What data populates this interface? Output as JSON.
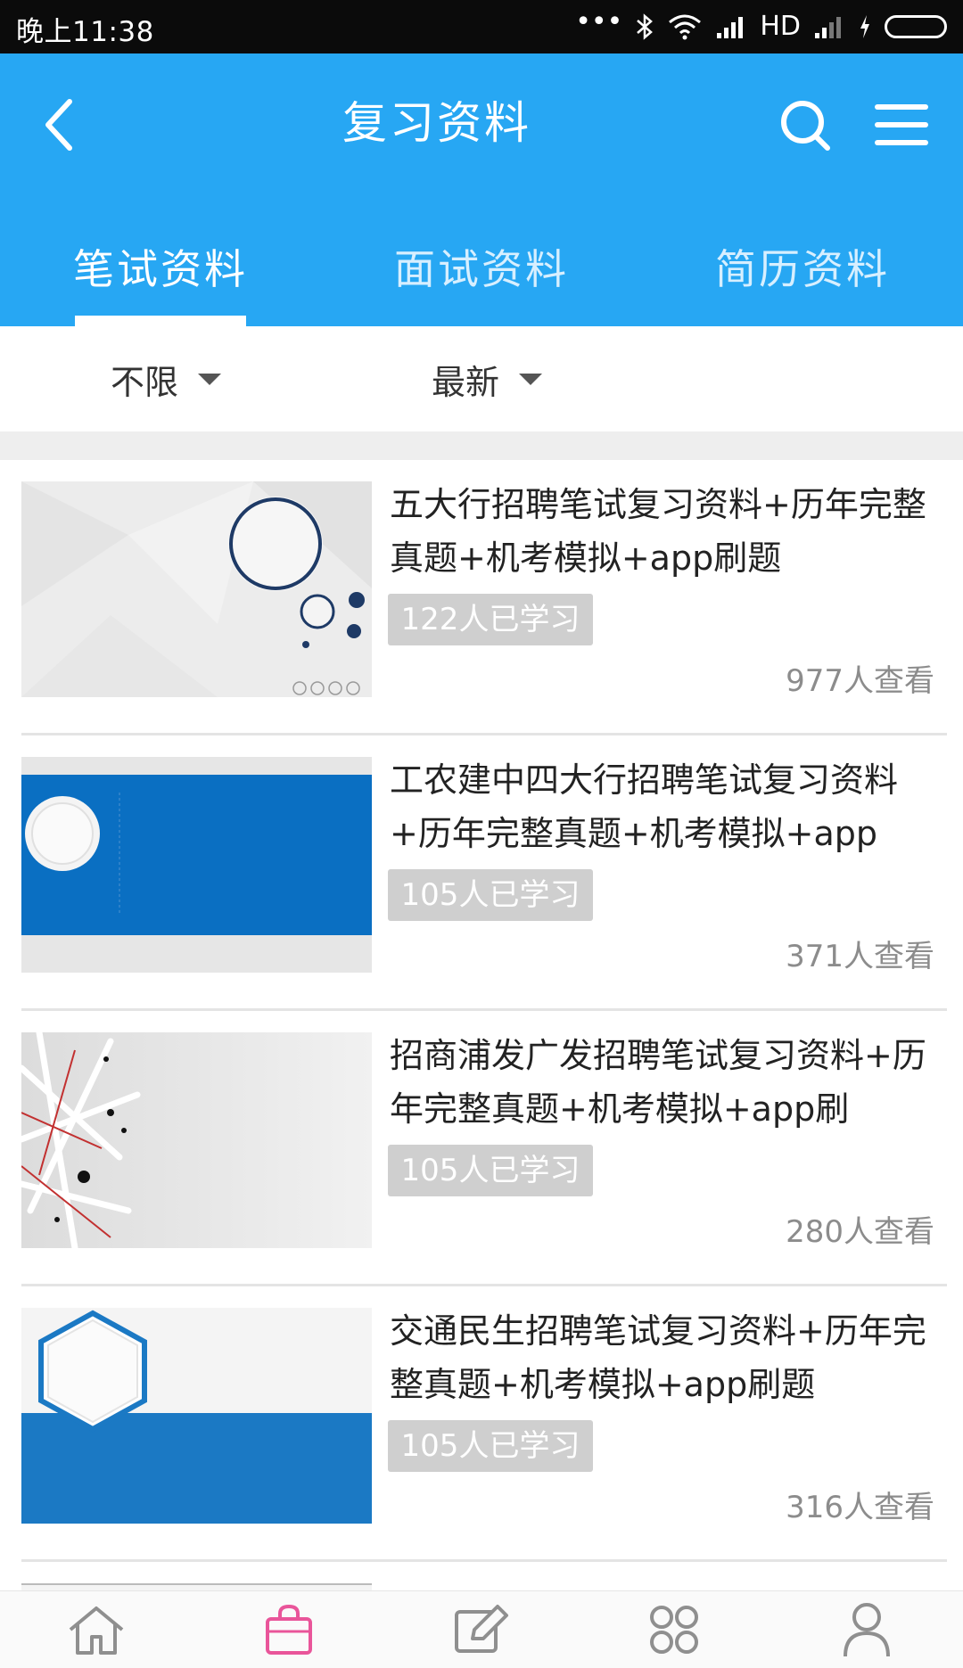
{
  "status_bar": {
    "time": "晚上11:38",
    "network": "HD",
    "dots": "•••"
  },
  "header": {
    "title": "复习资料",
    "back_icon": "chevron-left-icon",
    "search_icon": "search-icon",
    "menu_icon": "menu-icon",
    "background_color": "#27a7f3"
  },
  "tabs": [
    {
      "label": "笔试资料",
      "active": true
    },
    {
      "label": "面试资料",
      "active": false
    },
    {
      "label": "简历资料",
      "active": false
    }
  ],
  "filters": [
    {
      "label": "不限"
    },
    {
      "label": "最新"
    }
  ],
  "items": [
    {
      "title": "五大行招聘笔试复习资料+历年完整真题+机考模拟+app刷题",
      "learned": "122人已学习",
      "views": "977人查看"
    },
    {
      "title": "工农建中四大行招聘笔试复习资料+历年完整真题+机考模拟+app",
      "learned": "105人已学习",
      "views": "371人查看"
    },
    {
      "title": "招商浦发广发招聘笔试复习资料+历年完整真题+机考模拟+app刷",
      "learned": "105人已学习",
      "views": "280人查看"
    },
    {
      "title": "交通民生招聘笔试复习资料+历年完整真题+机考模拟+app刷题",
      "learned": "105人已学习",
      "views": "316人查看"
    }
  ],
  "bottom_nav": [
    {
      "icon": "home-icon",
      "active": false
    },
    {
      "icon": "shopping-bag-icon",
      "active": true
    },
    {
      "icon": "edit-icon",
      "active": false
    },
    {
      "icon": "apps-icon",
      "active": false
    },
    {
      "icon": "user-icon",
      "active": false
    }
  ],
  "colors": {
    "accent": "#27a7f3",
    "active_nav": "#e9559a",
    "badge": "#cfcfcf"
  }
}
